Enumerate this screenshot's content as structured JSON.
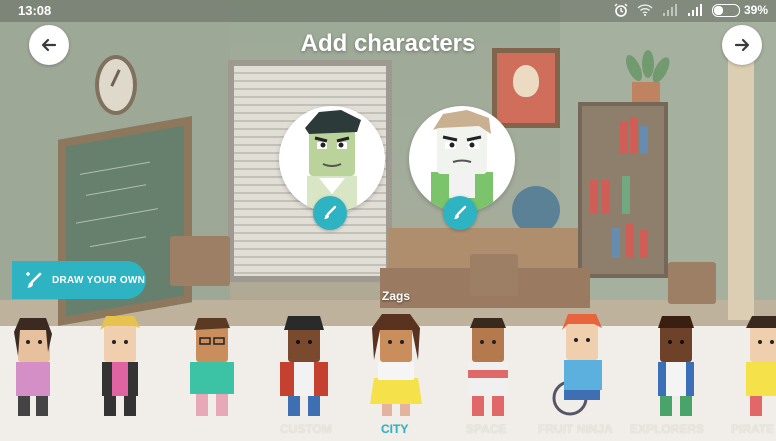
{
  "status_bar": {
    "time": "13:08",
    "battery": "39%",
    "battery_level": 0.39,
    "icons": [
      "alarm-icon",
      "wifi-icon",
      "signal-icon",
      "signal-icon",
      "battery-icon"
    ]
  },
  "header": {
    "title": "Add characters",
    "back_icon": "arrow-left-icon",
    "next_icon": "arrow-right-icon"
  },
  "selected_characters": {
    "edit_icon": "brush-icon",
    "accent_color": "#2eb3c2"
  },
  "draw_your_own": {
    "label": "DRAW YOUR OWN",
    "icon": "brush-sparkle-icon"
  },
  "current_character": {
    "name": "Zags"
  },
  "categories": {
    "tabs": [
      "CUSTOM",
      "CITY",
      "SPACE",
      "FRUIT NINJA",
      "EXPLORERS",
      "PIRATE"
    ],
    "active": "CITY"
  }
}
